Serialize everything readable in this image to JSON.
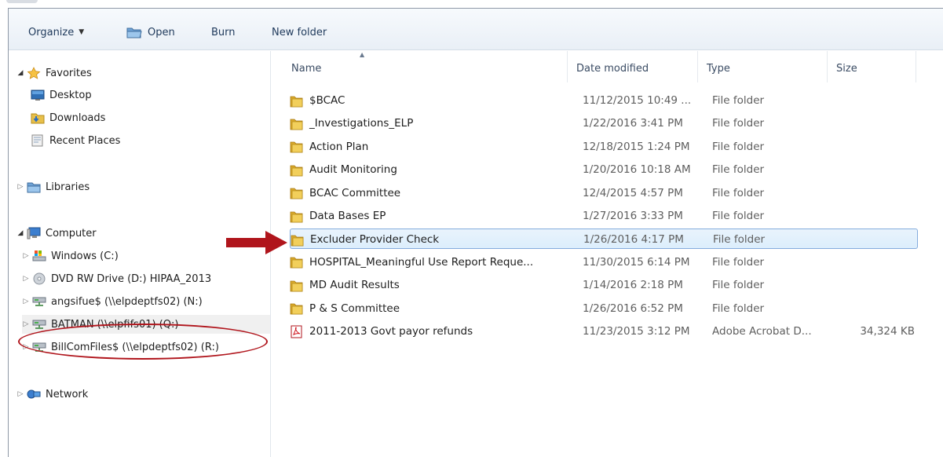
{
  "toolbar": {
    "organize_label": "Organize",
    "open_label": "Open",
    "burn_label": "Burn",
    "new_folder_label": "New folder"
  },
  "nav": {
    "favorites": {
      "label": "Favorites",
      "icon": "star-icon",
      "expanded": true
    },
    "favorites_items": [
      {
        "label": "Desktop",
        "icon": "desktop-icon"
      },
      {
        "label": "Downloads",
        "icon": "downloads-icon"
      },
      {
        "label": "Recent Places",
        "icon": "recent-places-icon"
      }
    ],
    "libraries": {
      "label": "Libraries",
      "icon": "libraries-icon",
      "expanded": false
    },
    "computer": {
      "label": "Computer",
      "icon": "computer-icon",
      "expanded": true
    },
    "computer_items": [
      {
        "label": "Windows (C:)",
        "icon": "hard-drive-icon"
      },
      {
        "label": "DVD RW Drive (D:) HIPAA_2013",
        "icon": "dvd-drive-icon"
      },
      {
        "label": "angsifue$ (\\\\elpdeptfs02) (N:)",
        "icon": "network-drive-icon"
      },
      {
        "label": "BATMAN (\\\\elpfifs01) (Q:)",
        "icon": "network-drive-icon"
      },
      {
        "label": "BillComFiles$ (\\\\elpdeptfs02) (R:)",
        "icon": "network-drive-icon"
      }
    ],
    "network": {
      "label": "Network",
      "icon": "network-icon",
      "expanded": false
    }
  },
  "columns": {
    "name": "Name",
    "date": "Date modified",
    "type": "Type",
    "size": "Size"
  },
  "files": [
    {
      "name": "$BCAC",
      "date": "11/12/2015 10:49 ...",
      "type": "File folder",
      "size": "",
      "icon": "folder-icon"
    },
    {
      "name": "_Investigations_ELP",
      "date": "1/22/2016 3:41 PM",
      "type": "File folder",
      "size": "",
      "icon": "folder-icon"
    },
    {
      "name": "Action Plan",
      "date": "12/18/2015 1:24 PM",
      "type": "File folder",
      "size": "",
      "icon": "folder-icon"
    },
    {
      "name": "Audit Monitoring",
      "date": "1/20/2016 10:18 AM",
      "type": "File folder",
      "size": "",
      "icon": "folder-icon"
    },
    {
      "name": "BCAC Committee",
      "date": "12/4/2015 4:57 PM",
      "type": "File folder",
      "size": "",
      "icon": "folder-icon"
    },
    {
      "name": "Data Bases EP",
      "date": "1/27/2016 3:33 PM",
      "type": "File folder",
      "size": "",
      "icon": "folder-icon"
    },
    {
      "name": "Excluder Provider Check",
      "date": "1/26/2016 4:17 PM",
      "type": "File folder",
      "size": "",
      "icon": "folder-icon",
      "selected": true
    },
    {
      "name": "HOSPITAL_Meaningful Use Report Reque...",
      "date": "11/30/2015 6:14 PM",
      "type": "File folder",
      "size": "",
      "icon": "folder-icon"
    },
    {
      "name": "MD Audit Results",
      "date": "1/14/2016 2:18 PM",
      "type": "File folder",
      "size": "",
      "icon": "folder-icon"
    },
    {
      "name": "P & S Committee",
      "date": "1/26/2016 6:52 PM",
      "type": "File folder",
      "size": "",
      "icon": "folder-icon"
    },
    {
      "name": "2011-2013 Govt payor refunds",
      "date": "11/23/2015 3:12 PM",
      "type": "Adobe Acrobat D...",
      "size": "34,324 KB",
      "icon": "pdf-icon"
    }
  ],
  "colors": {
    "annotation_red": "#b0151c",
    "selection_border": "#84acdd",
    "folder_yellow": "#e8c04a"
  }
}
